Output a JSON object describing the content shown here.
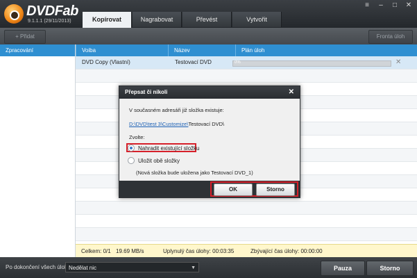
{
  "app": {
    "brand": "DVDFab",
    "version": "9.1.1.1 (29/11/2013)"
  },
  "tabs": [
    {
      "label": "Kopírovat",
      "active": true
    },
    {
      "label": "Nagrabovat",
      "active": false
    },
    {
      "label": "Převést",
      "active": false
    },
    {
      "label": "Vytvořit",
      "active": false
    }
  ],
  "toolbar": {
    "add_label": "+ Přidat",
    "queue_label": "Fronta úloh"
  },
  "sidebar": {
    "header": "Zpracování"
  },
  "columns": {
    "voiba": "Voiba",
    "nazev": "Název",
    "plan": "Plán úloh"
  },
  "task": {
    "voiba": "DVD Copy (Vlastní)",
    "nazev": "Testovací DVD",
    "progress_text": "0%",
    "progress": 0
  },
  "status": {
    "total": "Celkem: 0/1",
    "speed": "19.69 MB/s",
    "elapsed": "Uplynulý čas úlohy: 00:03:35",
    "remaining": "Zbývající čas úlohy: 00:00:00"
  },
  "bottom": {
    "after_label": "Po dokončení všech úloh:",
    "after_value": "Nedělat nic",
    "pause_label": "Pauza",
    "cancel_label": "Storno"
  },
  "dialog": {
    "title": "Přepsat či nikoli",
    "message": "V současném adresáři již složka existuje:",
    "path_link": "D:\\DVD\\test 3\\Customize\\",
    "path_rest": "Testovací DVD\\",
    "choose": "Zvolte:",
    "option_replace": "Nahradit existující složku",
    "option_keep": "Uložit obě složky",
    "note": "(Nová složka bude uložena jako Testovací DVD_1)",
    "ok_label": "OK",
    "cancel_label": "Storno"
  },
  "colors": {
    "accent": "#2f8fd1",
    "highlight": "#d6202a",
    "status_bg": "#fff7cc"
  }
}
